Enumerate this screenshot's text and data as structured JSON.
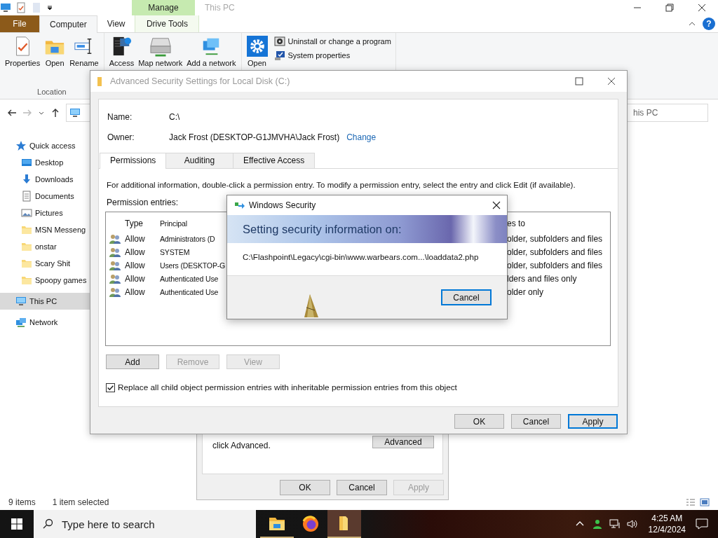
{
  "explorer": {
    "title": "This PC",
    "contextual_tab": "Manage",
    "help": "?",
    "tabs": [
      {
        "label": "File",
        "kind": "file",
        "selected": false
      },
      {
        "label": "Computer",
        "kind": "tab",
        "selected": true
      },
      {
        "label": "View",
        "kind": "tab",
        "selected": false
      },
      {
        "label": "Drive Tools",
        "kind": "contextual",
        "selected": false
      }
    ],
    "ribbon": [
      {
        "label": "Location",
        "buttons": [
          {
            "label": "Properties",
            "kind": "properties"
          },
          {
            "label": "Open",
            "kind": "open"
          },
          {
            "label": "Rename",
            "kind": "rename"
          }
        ]
      },
      {
        "buttons": [
          {
            "label": "Access",
            "kind": "access"
          },
          {
            "label": "Map network",
            "kind": "drive"
          },
          {
            "label": "Add a network",
            "kind": "network"
          }
        ]
      },
      {
        "buttons": [
          {
            "label": "Open",
            "kind": "settings"
          }
        ],
        "links": [
          {
            "label": "Uninstall or change a program",
            "kind": "uninstall"
          },
          {
            "label": "System properties",
            "kind": "system"
          }
        ]
      }
    ],
    "search": {
      "placeholder": "his PC"
    },
    "nav": [
      {
        "label": "Quick access",
        "kind": "star",
        "selected": false
      },
      {
        "label": "Desktop",
        "kind": "desktop",
        "selected": false
      },
      {
        "label": "Downloads",
        "kind": "download",
        "selected": false
      },
      {
        "label": "Documents",
        "kind": "document",
        "selected": false
      },
      {
        "label": "Pictures",
        "kind": "picture",
        "selected": false
      },
      {
        "label": "MSN Messeng",
        "kind": "folder",
        "selected": false
      },
      {
        "label": "onstar",
        "kind": "folder",
        "selected": false
      },
      {
        "label": "Scary Shit",
        "kind": "folder",
        "selected": false
      },
      {
        "label": "Spoopy games",
        "kind": "folder",
        "selected": false
      },
      {
        "label": "This PC",
        "kind": "pc",
        "selected": true
      },
      {
        "label": "Network",
        "kind": "network",
        "selected": false
      }
    ],
    "status_bar": {
      "items": "9 items",
      "selection": "1 item selected"
    }
  },
  "properties_dialog": {
    "text": [
      "click Advanced."
    ],
    "advanced_button": "Advanced",
    "buttons": [
      {
        "label": "OK",
        "disabled": false
      },
      {
        "label": "Cancel",
        "disabled": false
      },
      {
        "label": "Apply",
        "disabled": true
      }
    ]
  },
  "advanced_dialog": {
    "title": "Advanced Security Settings for Local Disk (C:)",
    "name_label": "Name:",
    "name": "C:\\",
    "owner_label": "Owner:",
    "owner": "Jack Frost (DESKTOP-G1JMVHA\\Jack Frost)",
    "change_link": "Change",
    "tabs": [
      {
        "label": "Permissions",
        "selected": true
      },
      {
        "label": "Auditing",
        "selected": false
      },
      {
        "label": "Effective Access",
        "selected": false
      }
    ],
    "description": "For additional information, double-click a permission entry. To modify a permission entry, select the entry and click Edit (if available).",
    "entries_label": "Permission entries:",
    "table": {
      "columns": [
        "Type",
        "Principal",
        "es to"
      ],
      "rows": [
        {
          "type": "Allow",
          "principal": "Administrators (D",
          "applies": "older, subfolders and files"
        },
        {
          "type": "Allow",
          "principal": "SYSTEM",
          "applies": "older, subfolders and files"
        },
        {
          "type": "Allow",
          "principal": "Users (DESKTOP-G",
          "applies": "older, subfolders and files"
        },
        {
          "type": "Allow",
          "principal": "Authenticated Use",
          "applies": "lders and files only"
        },
        {
          "type": "Allow",
          "principal": "Authenticated Use",
          "applies": "older only"
        }
      ]
    },
    "entry_buttons": [
      {
        "label": "Add",
        "disabled": false
      },
      {
        "label": "Remove",
        "disabled": true
      },
      {
        "label": "View",
        "disabled": true
      }
    ],
    "replace_checkbox": {
      "label": "Replace all child object permission entries with inheritable permission entries from this object",
      "checked": true
    },
    "buttons": [
      {
        "label": "OK",
        "focused": false
      },
      {
        "label": "Cancel",
        "focused": false
      },
      {
        "label": "Apply",
        "focused": true
      }
    ]
  },
  "security_dialog": {
    "title": "Windows Security",
    "heading": "Setting security information on:",
    "path": "C:\\Flashpoint\\Legacy\\cgi-bin\\www.warbears.com...\\loaddata2.php",
    "button": {
      "label": "Cancel",
      "focused": true
    }
  },
  "taskbar": {
    "search_placeholder": "Type here to search",
    "apps": [
      {
        "kind": "explorer",
        "running": true,
        "active": false
      },
      {
        "kind": "firefox",
        "running": false,
        "active": false
      },
      {
        "kind": "folder",
        "running": true,
        "active": true
      }
    ],
    "time": "4:25 AM",
    "date": "12/4/2024"
  }
}
